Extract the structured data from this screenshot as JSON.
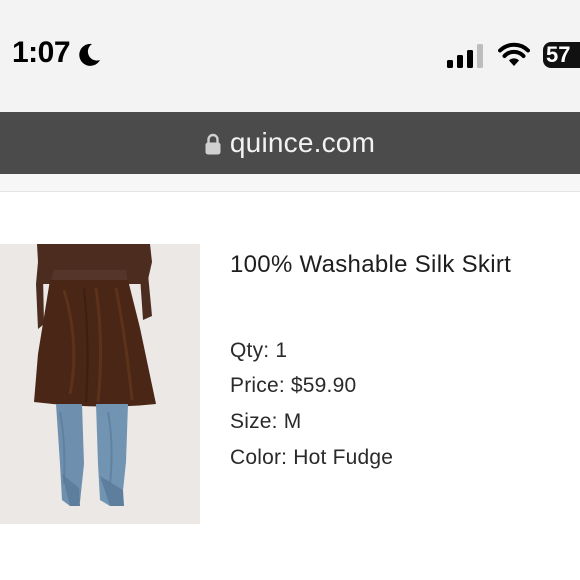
{
  "status_bar": {
    "time": "1:07",
    "battery": "57"
  },
  "browser": {
    "url": "quince.com"
  },
  "order_item": {
    "title": "100% Washable Silk Skirt",
    "qty": "Qty: 1",
    "price": "Price: $59.90",
    "size": "Size: M",
    "color": "Color: Hot Fudge",
    "skirt_color": "#4a2616"
  },
  "icons": {
    "focus": "moon-icon",
    "signal": "cellular-signal-icon",
    "wifi": "wifi-icon",
    "battery": "battery-icon",
    "secure": "lock-icon"
  }
}
